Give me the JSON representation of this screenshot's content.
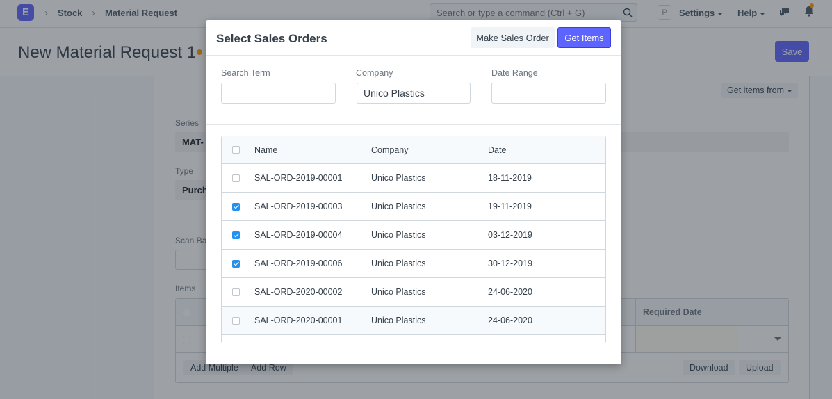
{
  "navbar": {
    "logo": "E",
    "breadcrumbs": [
      "Stock",
      "Material Request"
    ],
    "search_placeholder": "Search or type a command (Ctrl + G)",
    "avatar": "P",
    "settings_label": "Settings",
    "help_label": "Help"
  },
  "page": {
    "title": "New Material Request 1",
    "save_label": "Save"
  },
  "form": {
    "get_items_from": "Get items from",
    "series_label": "Series",
    "series_value": "MAT-",
    "type_label": "Type",
    "type_value": "Purch",
    "scan_label": "Scan Ba",
    "items_label": "Items",
    "required_date_header": "Required Date",
    "add_multiple": "Add Multiple",
    "add_row": "Add Row",
    "download": "Download",
    "upload": "Upload"
  },
  "modal": {
    "title": "Select Sales Orders",
    "make_sales_order": "Make Sales Order",
    "get_items": "Get Items",
    "filters": {
      "search_term_label": "Search Term",
      "search_term_value": "",
      "company_label": "Company",
      "company_value": "Unico Plastics",
      "date_range_label": "Date Range",
      "date_range_value": ""
    },
    "columns": [
      "Name",
      "Company",
      "Date"
    ],
    "rows": [
      {
        "name": "SAL-ORD-2019-00001",
        "company": "Unico Plastics",
        "date": "18-11-2019",
        "checked": false
      },
      {
        "name": "SAL-ORD-2019-00003",
        "company": "Unico Plastics",
        "date": "19-11-2019",
        "checked": true
      },
      {
        "name": "SAL-ORD-2019-00004",
        "company": "Unico Plastics",
        "date": "03-12-2019",
        "checked": true
      },
      {
        "name": "SAL-ORD-2019-00006",
        "company": "Unico Plastics",
        "date": "30-12-2019",
        "checked": true
      },
      {
        "name": "SAL-ORD-2020-00002",
        "company": "Unico Plastics",
        "date": "24-06-2020",
        "checked": false
      },
      {
        "name": "SAL-ORD-2020-00001",
        "company": "Unico Plastics",
        "date": "24-06-2020",
        "checked": false
      }
    ]
  },
  "colors": {
    "primary": "#5e64ff",
    "checkbox": "#2490ef",
    "notification": "#ffa00a"
  }
}
